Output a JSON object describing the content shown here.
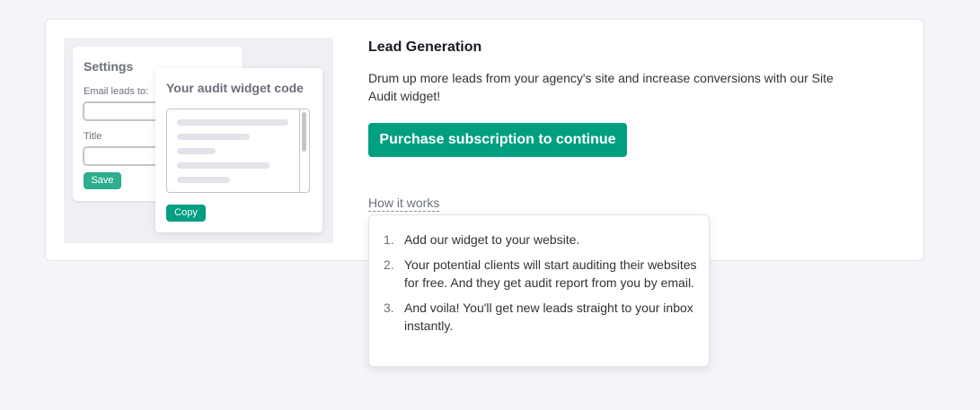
{
  "illustration": {
    "settings": {
      "title": "Settings",
      "email_label": "Email leads to:",
      "title_label": "Title",
      "save_label": "Save"
    },
    "widget": {
      "title": "Your audit widget code",
      "copy_label": "Copy"
    }
  },
  "main": {
    "heading": "Lead Generation",
    "description": "Drum up more leads from your agency's site and increase conversions with our Site Audit widget!",
    "purchase_label": "Purchase subscription to continue",
    "how_it_works_label": "How it works"
  },
  "popover": {
    "steps": [
      {
        "num": "1.",
        "text": "Add our widget to your website."
      },
      {
        "num": "2.",
        "text": "Your potential clients will start auditing their websites for free. And they get audit report from you by email."
      },
      {
        "num": "3.",
        "text": "And voila! You'll get new leads straight to your inbox instantly."
      }
    ]
  },
  "colors": {
    "primary": "#009f81",
    "background": "#f4f5f9",
    "card": "#ffffff"
  }
}
